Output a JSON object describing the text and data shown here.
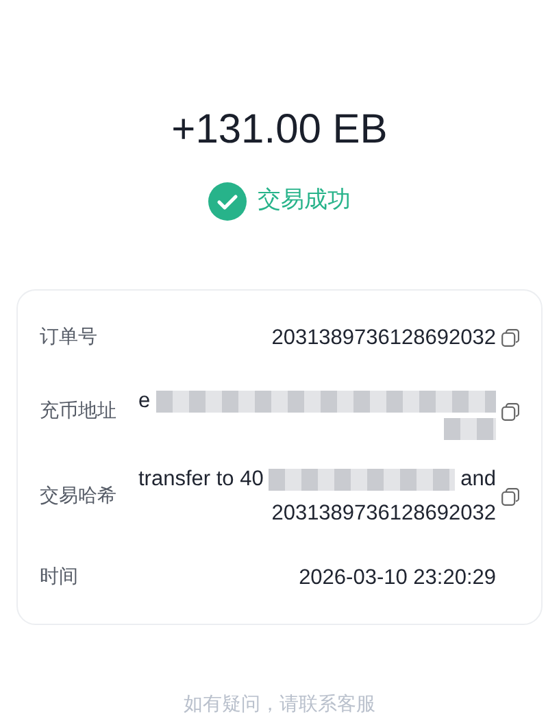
{
  "amount": "+131.00 EB",
  "status": {
    "kind": "success",
    "label": "交易成功"
  },
  "details": [
    {
      "label": "订单号",
      "copyable": true,
      "lines": [
        [
          {
            "kind": "text",
            "text": "2031389736128692032"
          }
        ]
      ]
    },
    {
      "label": "充币地址",
      "copyable": true,
      "lines": [
        [
          {
            "kind": "text",
            "text": "e"
          },
          {
            "kind": "blur",
            "wide": true
          }
        ],
        [
          {
            "kind": "blur",
            "wide": false
          }
        ]
      ]
    },
    {
      "label": "交易哈希",
      "copyable": true,
      "lines": [
        [
          {
            "kind": "text",
            "text": "transfer to 40"
          },
          {
            "kind": "blur",
            "wide": true
          },
          {
            "kind": "text",
            "text": "and"
          }
        ],
        [
          {
            "kind": "text",
            "text": "2031389736128692032"
          }
        ]
      ]
    },
    {
      "label": "时间",
      "copyable": false,
      "lines": [
        [
          {
            "kind": "text",
            "text": "2026-03-10 23:20:29"
          }
        ]
      ]
    }
  ],
  "footer": "如有疑问，请联系客服"
}
